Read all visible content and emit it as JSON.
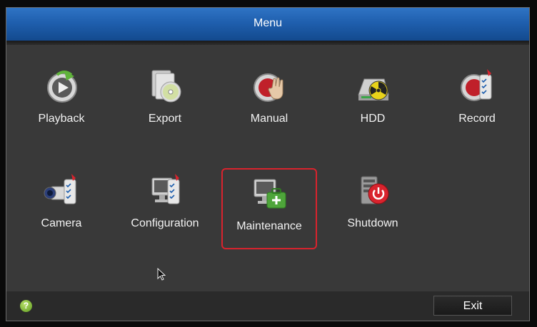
{
  "window": {
    "title": "Menu"
  },
  "menu": {
    "items": [
      {
        "id": "playback",
        "label": "Playback",
        "icon": "playback-icon"
      },
      {
        "id": "export",
        "label": "Export",
        "icon": "export-icon"
      },
      {
        "id": "manual",
        "label": "Manual",
        "icon": "manual-icon"
      },
      {
        "id": "hdd",
        "label": "HDD",
        "icon": "hdd-icon"
      },
      {
        "id": "record",
        "label": "Record",
        "icon": "record-icon"
      },
      {
        "id": "camera",
        "label": "Camera",
        "icon": "camera-icon"
      },
      {
        "id": "configuration",
        "label": "Configuration",
        "icon": "configuration-icon"
      },
      {
        "id": "maintenance",
        "label": "Maintenance",
        "icon": "maintenance-icon",
        "selected": true
      },
      {
        "id": "shutdown",
        "label": "Shutdown",
        "icon": "shutdown-icon"
      }
    ]
  },
  "footer": {
    "help_icon": "help-icon",
    "help_glyph": "?",
    "exit_label": "Exit"
  },
  "colors": {
    "title_bar": "#1f5fae",
    "panel": "#393939",
    "selection": "#d9232d",
    "help": "#7ab530"
  }
}
